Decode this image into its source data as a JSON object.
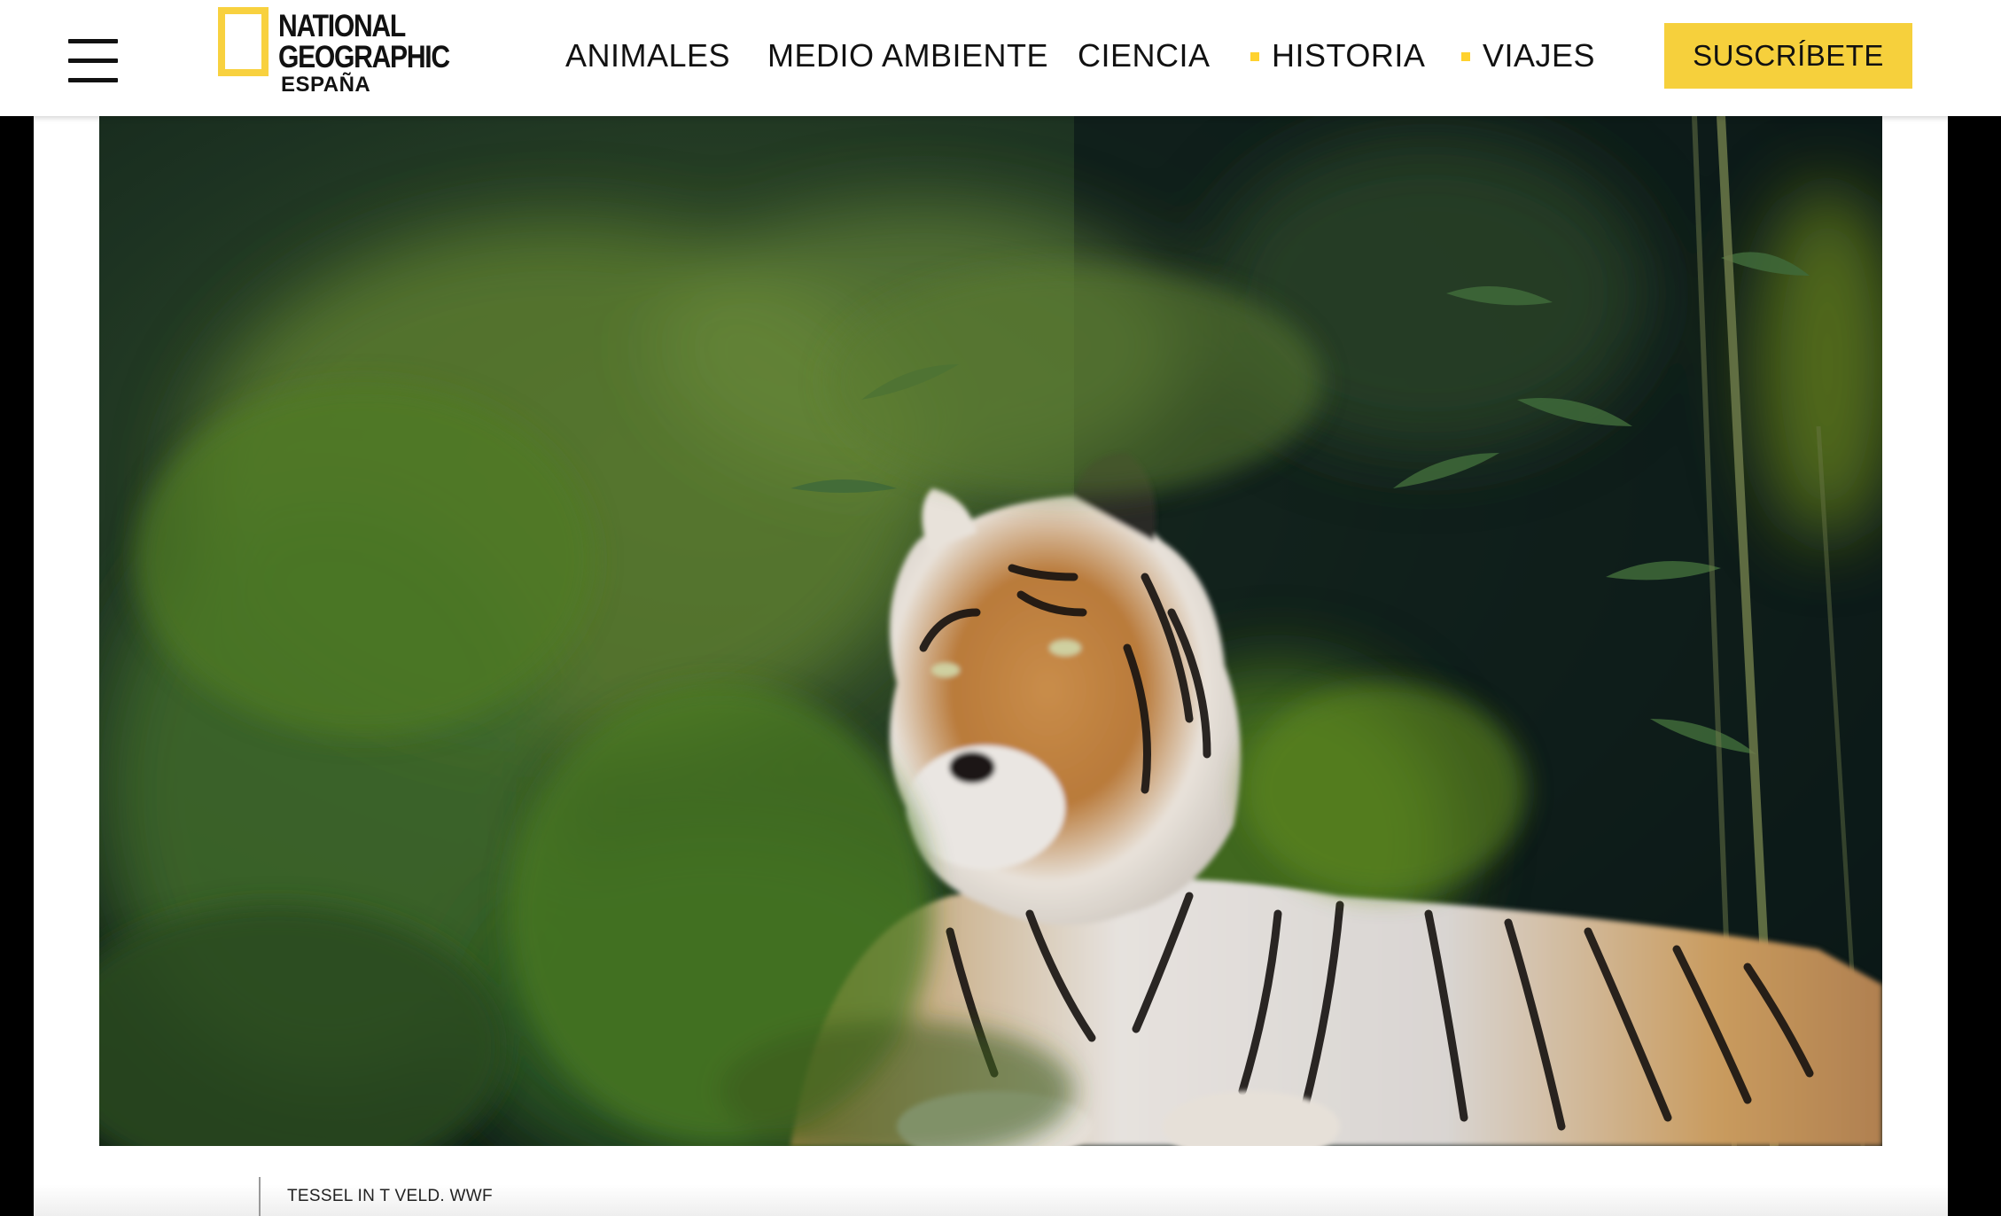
{
  "header": {
    "menu_icon": "hamburger-menu-icon",
    "logo": {
      "line1": "NATIONAL",
      "line2": "GEOGRAPHIC",
      "line3": "ESPAÑA",
      "frame_color": "#f8d13f"
    },
    "nav": [
      {
        "label": "ANIMALES",
        "bullet": false
      },
      {
        "label": "MEDIO AMBIENTE",
        "bullet": false
      },
      {
        "label": "CIENCIA",
        "bullet": false
      },
      {
        "label": "HISTORIA",
        "bullet": true
      },
      {
        "label": "VIAJES",
        "bullet": true
      }
    ],
    "subscribe_label": "SUSCRÍBETE",
    "accent_color": "#f6d03c"
  },
  "hero": {
    "image_subject": "tiger-photo"
  },
  "caption": {
    "credit": "TESSEL IN T VELD. WWF"
  }
}
